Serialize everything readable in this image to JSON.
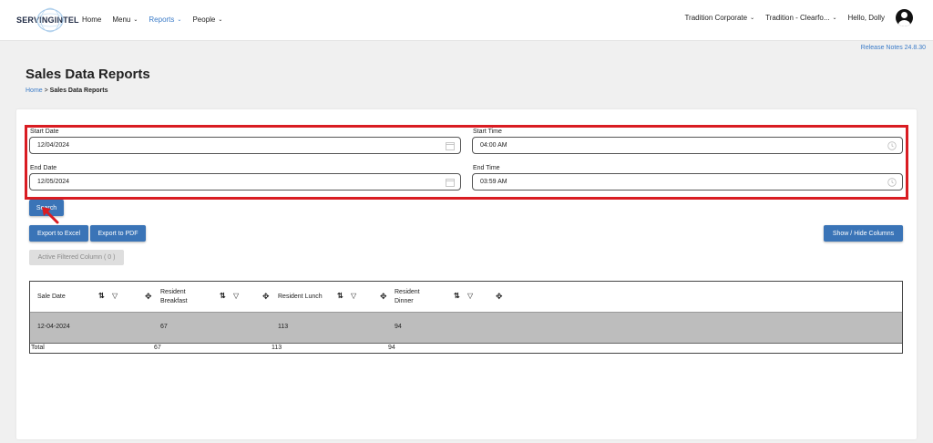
{
  "nav": {
    "brand_part1": "SERVING",
    "brand_part2": "INTEL",
    "items": [
      {
        "label": "Home",
        "dropdown": false,
        "active": false
      },
      {
        "label": "Menu",
        "dropdown": true,
        "active": false
      },
      {
        "label": "Reports",
        "dropdown": true,
        "active": true
      },
      {
        "label": "People",
        "dropdown": true,
        "active": false
      }
    ],
    "org": "Tradition Corporate",
    "location": "Tradition - Clearfo...",
    "greeting": "Hello, Dolly"
  },
  "release_notes": "Release Notes 24.8.30",
  "page": {
    "title": "Sales Data Reports",
    "breadcrumb_home": "Home",
    "breadcrumb_sep": " > ",
    "breadcrumb_current": "Sales Data Reports"
  },
  "form": {
    "start_date_label": "Start Date",
    "start_date_value": "12/04/2024",
    "start_time_label": "Start Time",
    "start_time_value": "04:00 AM",
    "end_date_label": "End Date",
    "end_date_value": "12/05/2024",
    "end_time_label": "End Time",
    "end_time_value": "03:59 AM"
  },
  "buttons": {
    "search": "Search",
    "export_excel": "Export to Excel",
    "export_pdf": "Export to PDF",
    "show_hide": "Show / Hide Columns",
    "active_filtered": "Active Filtered Column ( 0 )"
  },
  "table": {
    "columns": [
      {
        "line1": "Sale Date",
        "line2": ""
      },
      {
        "line1": "Resident",
        "line2": "Breakfast"
      },
      {
        "line1": "Resident Lunch",
        "line2": ""
      },
      {
        "line1": "Resident",
        "line2": "Dinner"
      }
    ],
    "rows": [
      [
        "12-04-2024",
        "67",
        "113",
        "94"
      ]
    ],
    "total_label": "Total",
    "totals": [
      "67",
      "113",
      "94"
    ]
  },
  "colors": {
    "accent": "#3a74b7",
    "link": "#3a7bc8",
    "highlight_border": "#d91c22",
    "row_bg": "#bdbdbd"
  },
  "icons": [
    "user-avatar-icon",
    "calendar-icon",
    "clock-icon",
    "sort-icon",
    "filter-icon",
    "column-move-icon",
    "cursor-arrow-icon"
  ]
}
